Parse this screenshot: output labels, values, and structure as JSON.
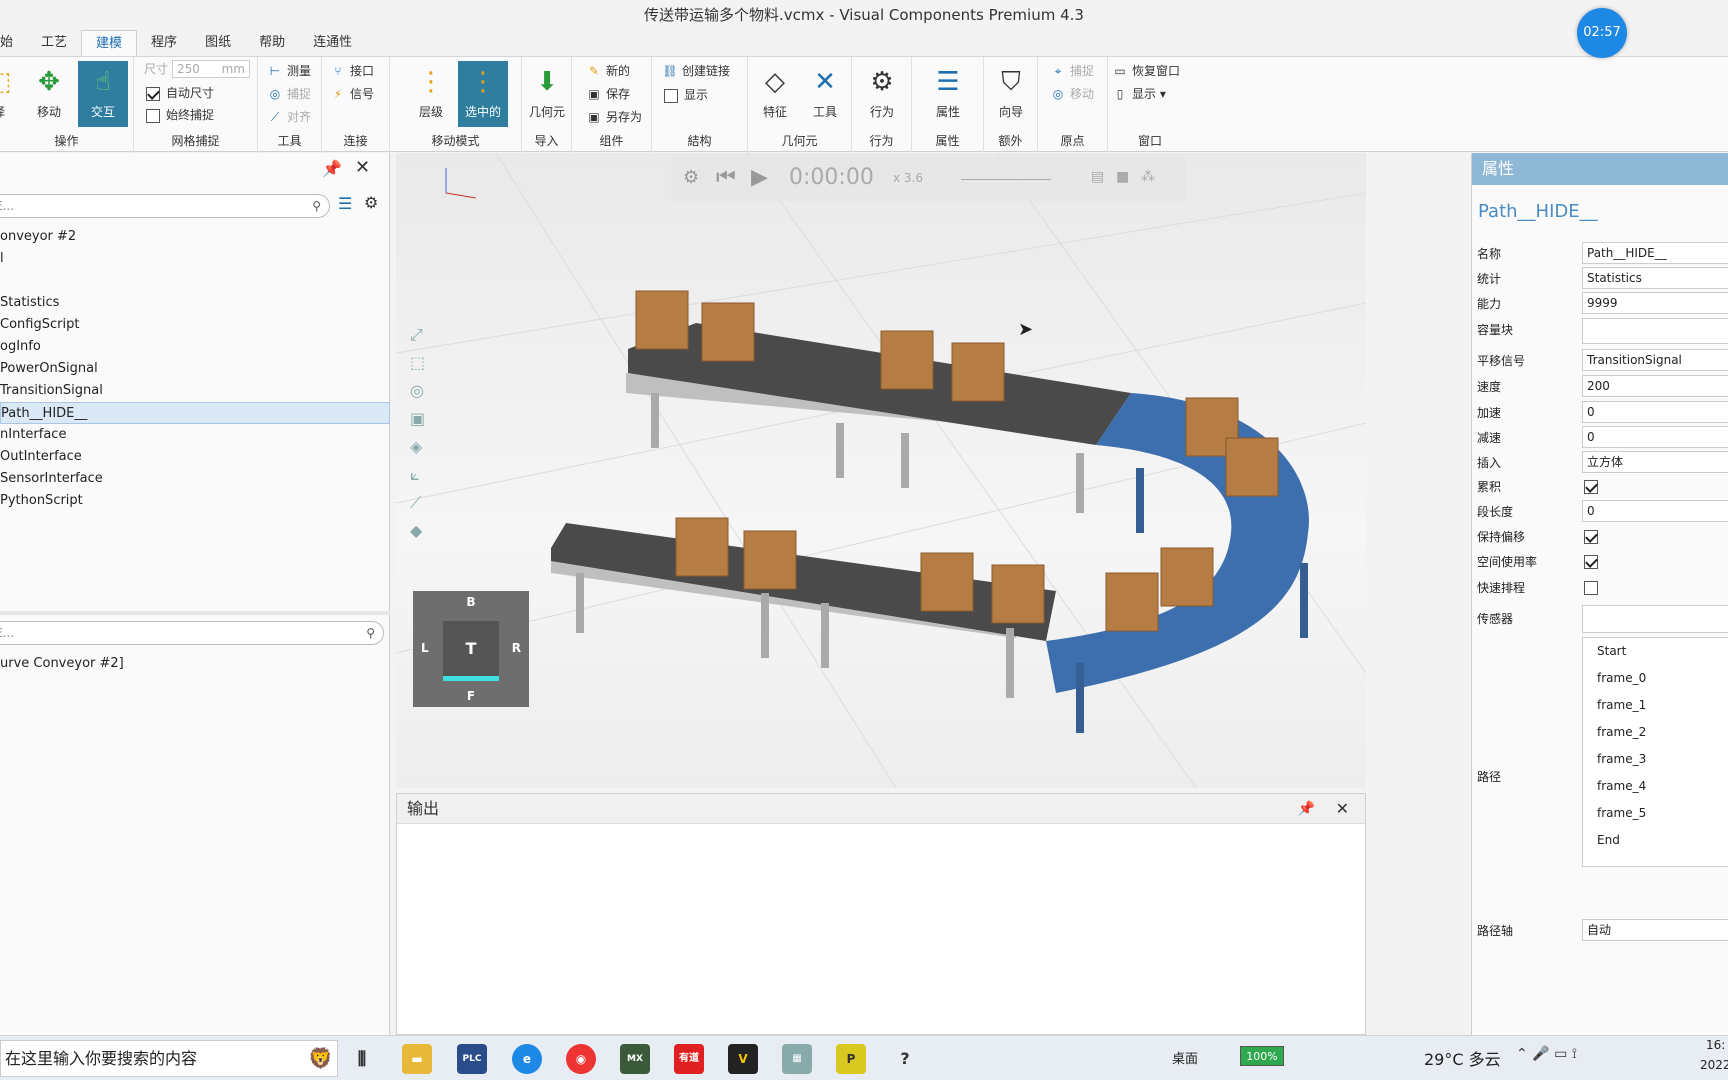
{
  "window": {
    "title": "传送带运输多个物料.vcmx - Visual Components Premium 4.3",
    "timer": "02:57"
  },
  "tabs": [
    {
      "label": "始"
    },
    {
      "label": "工艺"
    },
    {
      "label": "建模"
    },
    {
      "label": "程序"
    },
    {
      "label": "图纸"
    },
    {
      "label": "帮助"
    },
    {
      "label": "连通性"
    }
  ],
  "ribbon": {
    "ops": {
      "group": "操作",
      "partial": "择",
      "move": "移动",
      "interact": "交互"
    },
    "grid": {
      "group": "网格捕捉",
      "size_label": "尺寸",
      "size_value": "250",
      "size_unit": "mm",
      "auto_size": "自动尺寸",
      "always_snap": "始终捕捉"
    },
    "tools": {
      "group": "工具",
      "measure": "测量",
      "snap": "捕捉",
      "align": "对齐"
    },
    "connect": {
      "group": "连接",
      "interface": "接口",
      "signal": "信号"
    },
    "movemode": {
      "group": "移动模式",
      "hierarchy": "层级",
      "selected": "选中的"
    },
    "import": {
      "group": "导入",
      "geometry": "几何元"
    },
    "component": {
      "group": "组件",
      "new": "新的",
      "save": "保存",
      "save_as": "另存为"
    },
    "structure": {
      "group": "結构",
      "create_link": "创建链接",
      "show": "显示"
    },
    "geom": {
      "group": "几何元",
      "feature": "特征",
      "tool": "工具"
    },
    "behavior": {
      "group": "行为",
      "label": "行为"
    },
    "property": {
      "group": "属性",
      "label": "属性"
    },
    "extra": {
      "group": "额外",
      "wizard": "向导"
    },
    "origin": {
      "group": "原点",
      "snap": "捕捉",
      "move": "移动"
    },
    "window": {
      "group": "窗口",
      "restore": "恢复窗口",
      "show": "显示 ▾"
    }
  },
  "left": {
    "search_placeholder": "E...",
    "items": [
      {
        "label": "onveyor #2"
      },
      {
        "label": "l"
      },
      {
        "label": ""
      },
      {
        "label": "Statistics"
      },
      {
        "label": "ConfigScript"
      },
      {
        "label": "ogInfo"
      },
      {
        "label": "PowerOnSignal"
      },
      {
        "label": "TransitionSignal"
      },
      {
        "label": "Path__HIDE__"
      },
      {
        "label": "nInterface"
      },
      {
        "label": "OutInterface"
      },
      {
        "label": "SensorInterface"
      },
      {
        "label": "PythonScript"
      }
    ],
    "search2_placeholder": "E...",
    "bottom_item": "urve Conveyor #2]"
  },
  "viewport": {
    "time": "0:00:00",
    "speed": "x 3.6",
    "cube": {
      "top": "T",
      "back": "B",
      "front": "F",
      "left": "L",
      "right": "R"
    }
  },
  "output": {
    "title": "输出"
  },
  "properties": {
    "header": "属性",
    "component": "Path__HIDE__",
    "rows": [
      {
        "label": "名称",
        "value": "Path__HIDE__"
      },
      {
        "label": "统计",
        "value": "Statistics"
      },
      {
        "label": "能力",
        "value": "9999"
      },
      {
        "label": "容量块",
        "value": ""
      },
      {
        "label": "平移信号",
        "value": "TransitionSignal"
      },
      {
        "label": "速度",
        "value": "200"
      },
      {
        "label": "加速",
        "value": "0"
      },
      {
        "label": "减速",
        "value": "0"
      },
      {
        "label": "插入",
        "value": "立方体"
      },
      {
        "label": "累积",
        "value": ""
      },
      {
        "label": "段长度",
        "value": "0"
      },
      {
        "label": "保持偏移",
        "value": ""
      },
      {
        "label": "空间使用率",
        "value": ""
      },
      {
        "label": "快速排程",
        "value": ""
      },
      {
        "label": "传感器",
        "value": ""
      }
    ],
    "checks": {
      "accumulate": true,
      "keep_offset": true,
      "space_usage": true,
      "fast_schedule": false
    },
    "path_label": "路径",
    "path_items": [
      "Start",
      "frame_0",
      "frame_1",
      "frame_2",
      "frame_3",
      "frame_4",
      "frame_5",
      "End"
    ],
    "path_axis_label": "路径轴",
    "path_axis_value": "自动"
  },
  "taskbar": {
    "search": "在这里输入你要搜索的内容",
    "desktop": "桌面",
    "battery": "100%",
    "weather": "29°C 多云",
    "clock_time": "16:",
    "clock_date": "2022"
  },
  "colors": {
    "accent": "#2f7ea0",
    "conveyor_blue": "#3d6fae",
    "box": "#b57c44"
  }
}
